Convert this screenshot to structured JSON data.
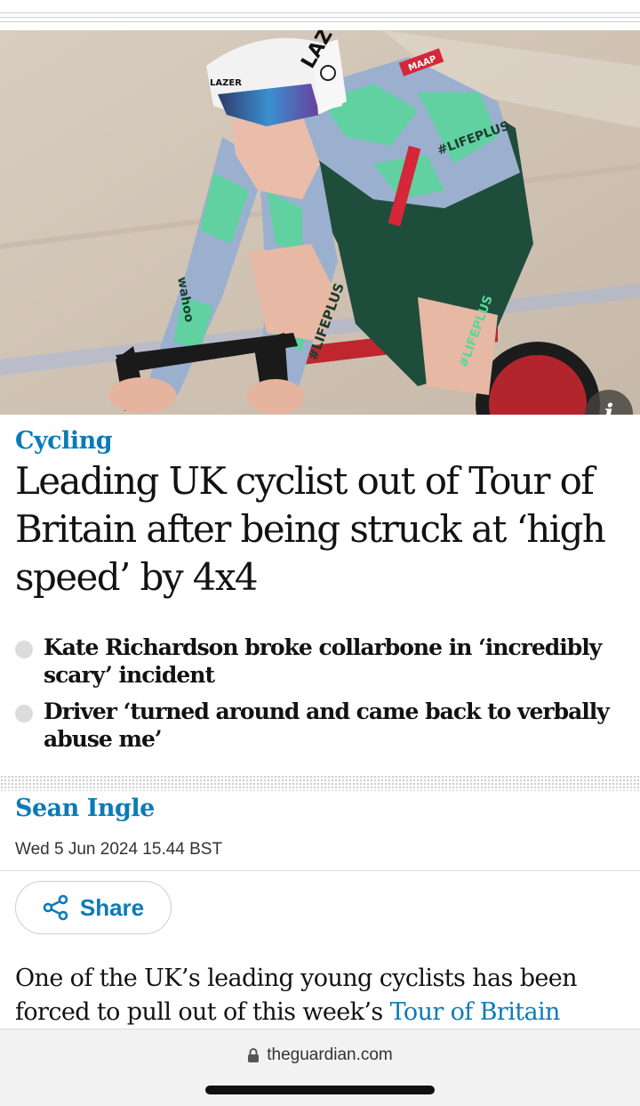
{
  "hero_image": {
    "alt_subject": "Cyclist on track bike",
    "helmet_brand": "LAZER",
    "helmet_mark": "LAZ",
    "sleeve_text": "#LIFEPLUS",
    "sponsor_text": "wahoo",
    "jersey_brand": "MAAP",
    "info_label": "i"
  },
  "article": {
    "kicker": "Cycling",
    "headline": "Leading UK cyclist out of Tour of Britain after being struck at ‘high speed’ by 4x4",
    "standfirst": [
      "Kate Richardson broke collarbone in ‘incredibly scary’ incident",
      "Driver ‘turned around and came back to verbally abuse me’"
    ],
    "byline": "Sean Ingle",
    "dateline": "Wed 5 Jun 2024 15.44 BST",
    "share_label": "Share",
    "body_start": "One of the UK’s leading young cyclists has been forced to pull out of this week’s ",
    "body_link": "Tour of Britain"
  },
  "browser": {
    "url": "theguardian.com"
  },
  "colors": {
    "accent": "#0a7bb8",
    "text": "#121212"
  }
}
